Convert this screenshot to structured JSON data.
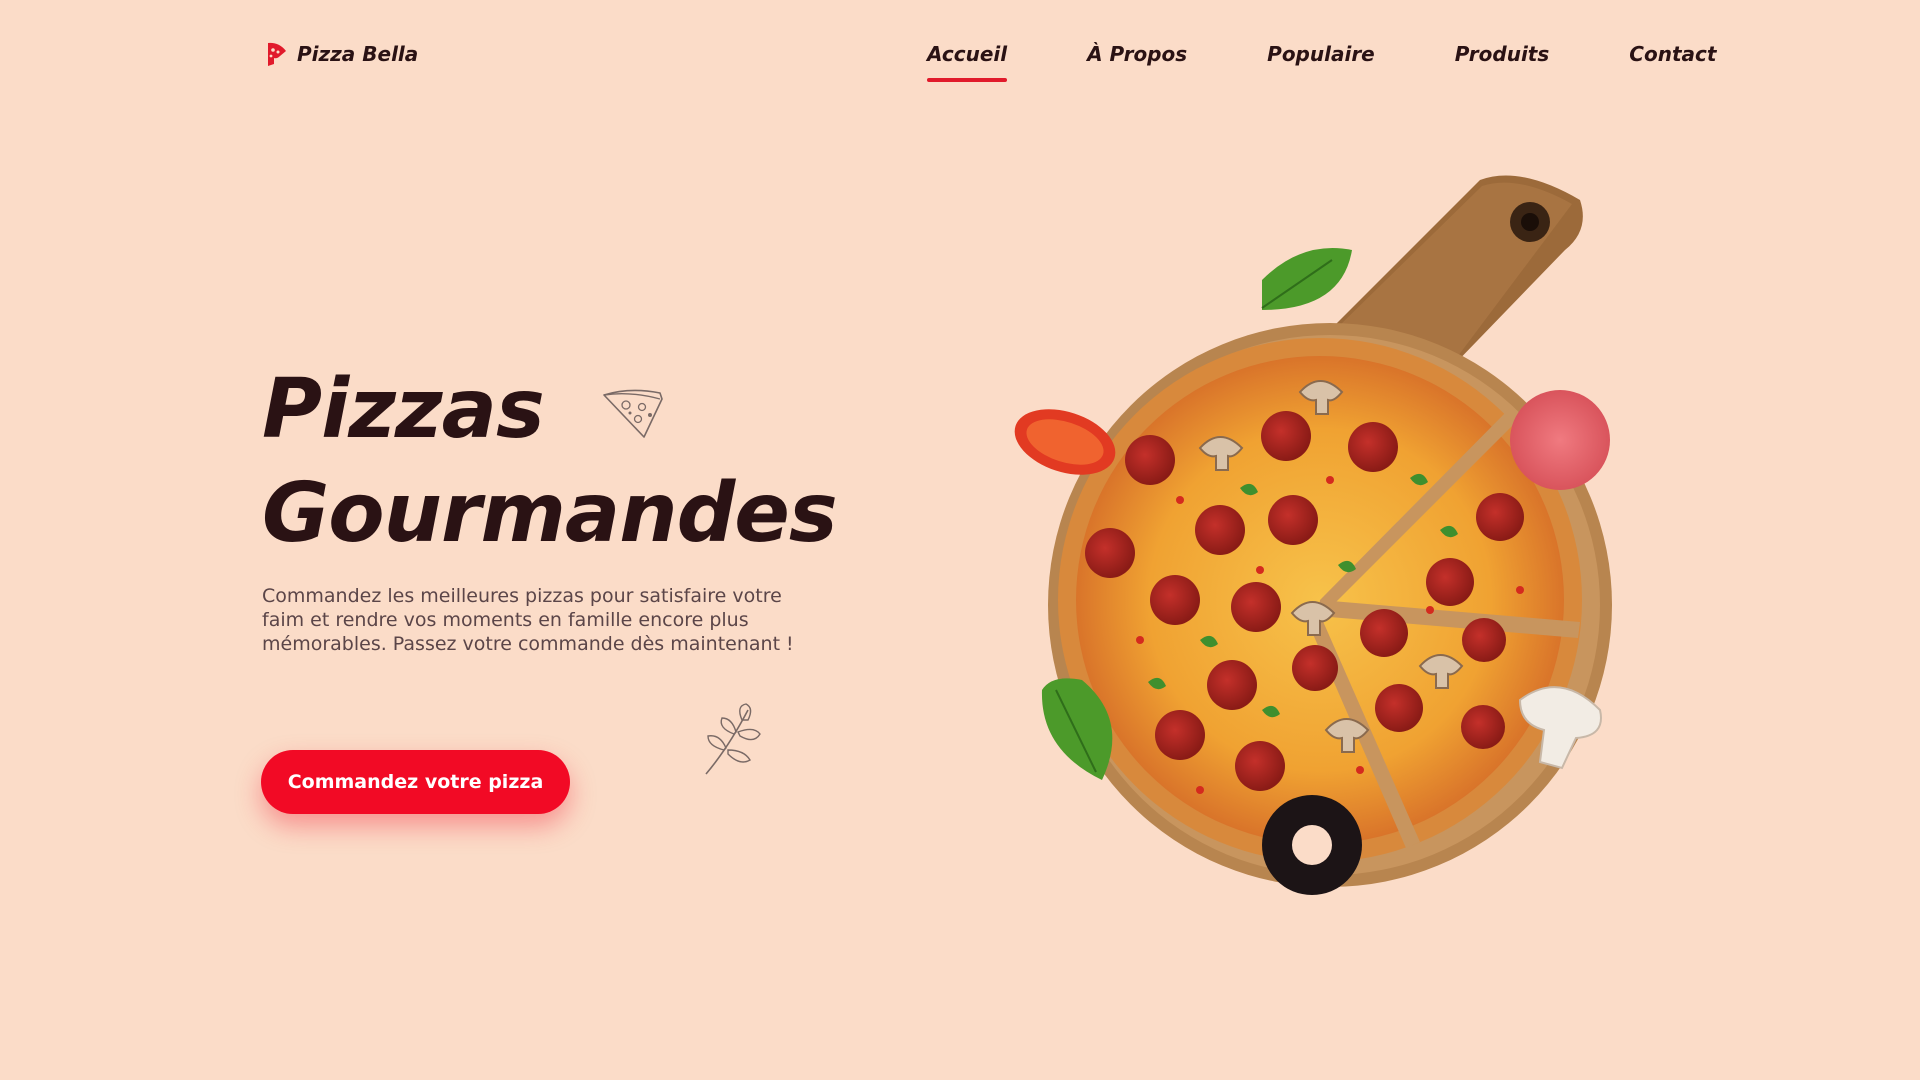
{
  "brand": {
    "name": "Pizza Bella",
    "accent": "#e11a2b",
    "logo_icon": "pizza-slice-icon"
  },
  "nav": {
    "items": [
      {
        "label": "Accueil",
        "active": true
      },
      {
        "label": "À Propos",
        "active": false
      },
      {
        "label": "Populaire",
        "active": false
      },
      {
        "label": "Produits",
        "active": false
      },
      {
        "label": "Contact",
        "active": false
      }
    ]
  },
  "hero": {
    "title_line1": "Pizzas",
    "title_line2": "Gourmandes",
    "description": "Commandez les meilleures pizzas pour satisfaire votre faim et rendre vos moments en famille encore plus mémorables. Passez votre commande dès maintenant !",
    "cta_label": "Commandez votre pizza"
  },
  "colors": {
    "background": "#fbdcc8",
    "text_dark": "#2a1214",
    "button": "#f20a25"
  }
}
